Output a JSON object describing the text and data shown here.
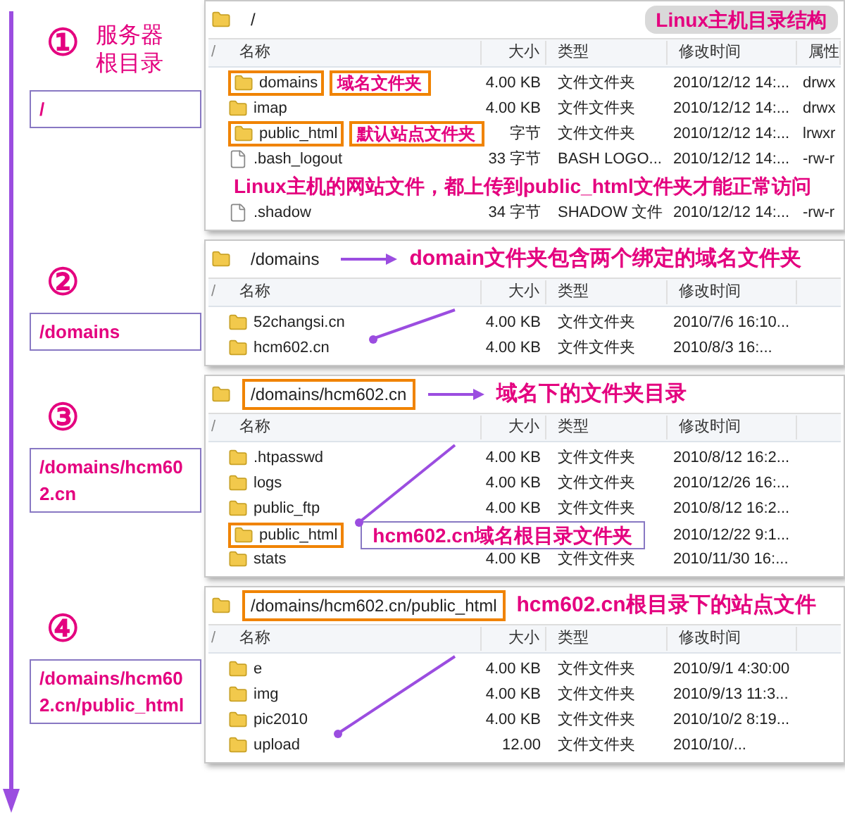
{
  "sections": [
    {
      "step": {
        "number": "①",
        "title_lines": [
          "服务器",
          "根目录"
        ],
        "path": "/"
      },
      "panel": {
        "path": "/",
        "path_highlighted": false,
        "badge": "Linux主机目录结构",
        "sort_indicator": "/",
        "columns": [
          "名称",
          "大小",
          "类型",
          "修改时间",
          "属性"
        ],
        "rows": [
          {
            "kind": "folder",
            "cells": [
              "domains",
              "4.00 KB",
              "文件文件夹",
              "2010/12/12 14:...",
              "drwx"
            ],
            "highlighted": true,
            "note": "域名文件夹"
          },
          {
            "kind": "folder",
            "cells": [
              "imap",
              "4.00 KB",
              "文件文件夹",
              "2010/12/12 14:...",
              "drwx"
            ],
            "highlighted": false
          },
          {
            "kind": "folder",
            "cells": [
              "public_html",
              "字节",
              "文件文件夹",
              "2010/12/12 14:...",
              "lrwxr"
            ],
            "highlighted": true,
            "note": "默认站点文件夹"
          },
          {
            "kind": "file",
            "cells": [
              ".bash_logout",
              "33 字节",
              "BASH LOGO...",
              "2010/12/12 14:...",
              "-rw-r"
            ],
            "highlighted": false
          },
          {
            "kind": "note",
            "text": "Linux主机的网站文件，都上传到public_html文件夹才能正常访问"
          },
          {
            "kind": "file",
            "cells": [
              ".shadow",
              "34 字节",
              "SHADOW 文件",
              "2010/12/12 14:...",
              "-rw-r"
            ],
            "highlighted": false
          }
        ]
      }
    },
    {
      "step": {
        "number": "②",
        "path": "/domains"
      },
      "panel": {
        "path": "/domains",
        "path_highlighted": false,
        "path_note": "domain文件夹包含两个绑定的域名文件夹",
        "path_note_arrow": true,
        "sort_indicator": "/",
        "columns": [
          "名称",
          "大小",
          "类型",
          "修改时间"
        ],
        "rows": [
          {
            "kind": "folder",
            "cells": [
              "52changsi.cn",
              "4.00 KB",
              "文件文件夹",
              "2010/7/6 16:10..."
            ],
            "highlighted": false
          },
          {
            "kind": "folder",
            "cells": [
              "hcm602.cn",
              "4.00 KB",
              "文件文件夹",
              "2010/8/3 16:..."
            ],
            "highlighted": false
          }
        ]
      }
    },
    {
      "step": {
        "number": "③",
        "path": "/domains/hcm602.cn"
      },
      "panel": {
        "path": "/domains/hcm602.cn",
        "path_highlighted": true,
        "path_note": "域名下的文件夹目录",
        "path_note_arrow": true,
        "sort_indicator": "/",
        "columns": [
          "名称",
          "大小",
          "类型",
          "修改时间"
        ],
        "rows": [
          {
            "kind": "folder",
            "cells": [
              ".htpasswd",
              "4.00 KB",
              "文件文件夹",
              "2010/8/12 16:2..."
            ],
            "highlighted": false
          },
          {
            "kind": "folder",
            "cells": [
              "logs",
              "4.00 KB",
              "文件文件夹",
              "2010/12/26 16:..."
            ],
            "highlighted": false
          },
          {
            "kind": "folder",
            "cells": [
              "public_ftp",
              "4.00 KB",
              "文件文件夹",
              "2010/8/12 16:2..."
            ],
            "highlighted": false
          },
          {
            "kind": "folder",
            "cells": [
              "public_html",
              null,
              null,
              "2010/12/22 9:1..."
            ],
            "highlighted": true,
            "callout": "hcm602.cn域名根目录文件夹"
          },
          {
            "kind": "folder",
            "cells": [
              "stats",
              "4.00 KB",
              "文件文件夹",
              "2010/11/30 16:..."
            ],
            "highlighted": false
          }
        ]
      }
    },
    {
      "step": {
        "number": "④",
        "path": "/domains/hcm602.cn/public_html"
      },
      "panel": {
        "path": "/domains/hcm602.cn/public_html",
        "path_highlighted": true,
        "path_note": "hcm602.cn根目录下的站点文件",
        "path_note_arrow": false,
        "sort_indicator": "/",
        "columns": [
          "名称",
          "大小",
          "类型",
          "修改时间"
        ],
        "rows": [
          {
            "kind": "folder",
            "cells": [
              "e",
              "4.00 KB",
              "文件文件夹",
              "2010/9/1 4:30:00"
            ],
            "highlighted": false
          },
          {
            "kind": "folder",
            "cells": [
              "img",
              "4.00 KB",
              "文件文件夹",
              "2010/9/13 11:3..."
            ],
            "highlighted": false
          },
          {
            "kind": "folder",
            "cells": [
              "pic2010",
              "4.00 KB",
              "文件文件夹",
              "2010/10/2 8:19..."
            ],
            "highlighted": false
          },
          {
            "kind": "folder",
            "cells": [
              "upload",
              "12.00",
              "文件文件夹",
              "2010/10/..."
            ],
            "highlighted": false
          }
        ]
      }
    }
  ]
}
